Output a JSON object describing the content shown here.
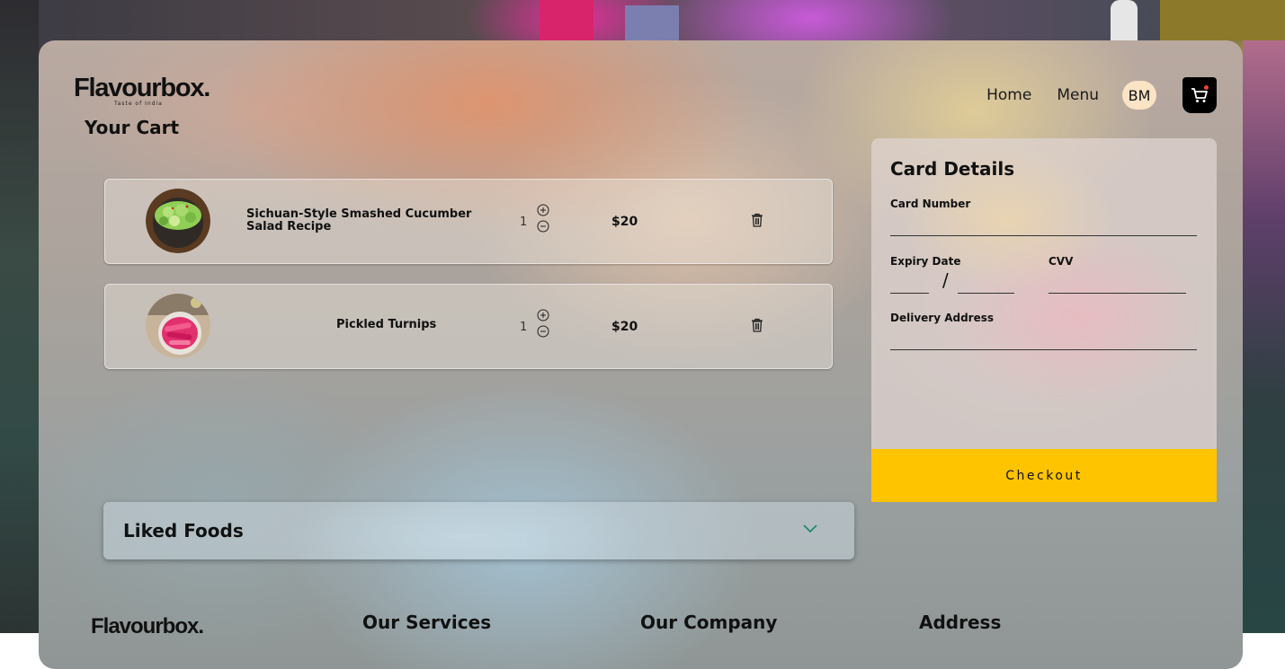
{
  "brand": {
    "name": "Flavourbox.",
    "tagline": "Taste of India"
  },
  "page": {
    "title": "Your Cart"
  },
  "nav": {
    "home": "Home",
    "menu": "Menu",
    "avatar_initials": "BM",
    "cart_icon": "cart-icon"
  },
  "cart": {
    "items": [
      {
        "name": "Sichuan-Style Smashed Cucumber Salad Recipe",
        "quantity": "1",
        "price": "$20"
      },
      {
        "name": "Pickled Turnips",
        "quantity": "1",
        "price": "$20"
      }
    ]
  },
  "card_details": {
    "title": "Card Details",
    "card_number_label": "Card Number",
    "expiry_label": "Expiry Date",
    "cvv_label": "CVV",
    "address_label": "Delivery Address",
    "expiry_separator": "/",
    "checkout_label": "Checkout"
  },
  "liked": {
    "title": "Liked Foods"
  },
  "footer": {
    "logo": "Flavourbox.",
    "services": "Our Services",
    "company": "Our Company",
    "address": "Address"
  },
  "colors": {
    "checkout": "#ffc400",
    "avatar_bg": "#fbe3c5",
    "chevron": "#1f8a6a"
  }
}
